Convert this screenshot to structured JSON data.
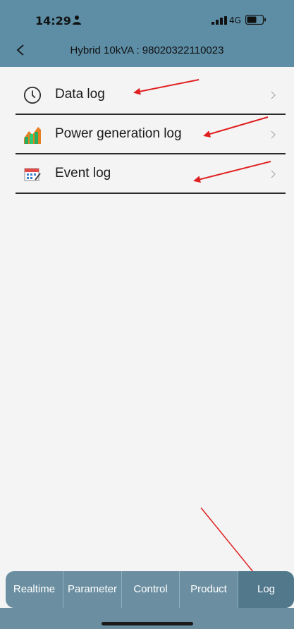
{
  "status_bar": {
    "time": "14:29",
    "network": "4G",
    "icons": [
      "person-icon",
      "signal-icon",
      "battery-icon"
    ]
  },
  "header": {
    "title": "Hybrid 10kVA : 98020322110023",
    "back_icon": "chevron-left-icon",
    "background": "#5d8ea6"
  },
  "menu": {
    "items": [
      {
        "label": "Data log",
        "icon": "clock-icon"
      },
      {
        "label": "Power generation log",
        "icon": "chart-icon"
      },
      {
        "label": "Event log",
        "icon": "calendar-icon"
      }
    ]
  },
  "tabbar": {
    "tabs": [
      {
        "label": "Realtime"
      },
      {
        "label": "Parameter"
      },
      {
        "label": "Control"
      },
      {
        "label": "Product"
      },
      {
        "label": "Log"
      }
    ],
    "active": "Log",
    "background": "#6b8fa1",
    "active_background": "#52788c"
  },
  "annotation_color": "#e02020"
}
